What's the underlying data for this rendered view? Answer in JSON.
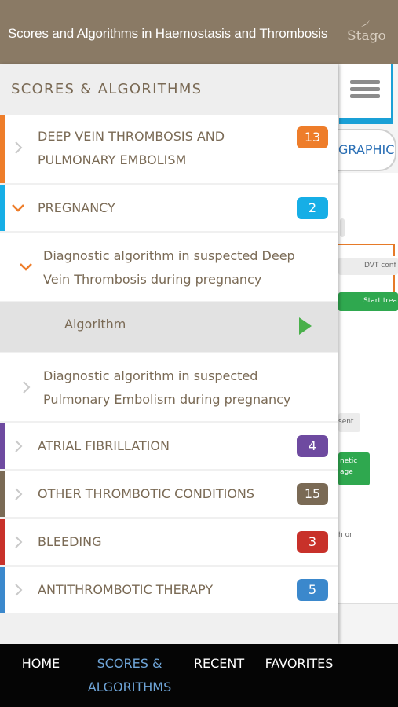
{
  "app": {
    "title": "Scores and Algorithms in Haemostasis and Thrombosis",
    "logo_text": "Stago"
  },
  "panel": {
    "title": "SCORES & ALGORITHMS"
  },
  "categories": [
    {
      "line1": "DEEP VEIN THROMBOSIS AND",
      "line2": "PULMONARY EMBOLISM",
      "count": "13",
      "color": "#ee7d2a",
      "expanded": false
    },
    {
      "line1": "PREGNANCY",
      "count": "2",
      "color": "#16aee6",
      "expanded": true
    },
    {
      "line1": "ATRIAL FIBRILLATION",
      "count": "4",
      "color": "#6e4aa0",
      "expanded": false
    },
    {
      "line1": "OTHER THROMBOTIC CONDITIONS",
      "count": "15",
      "color": "#7a6a55",
      "expanded": false
    },
    {
      "line1": "BLEEDING",
      "count": "3",
      "color": "#c8312a",
      "expanded": false
    },
    {
      "line1": "ANTITHROMBOTIC THERAPY",
      "count": "5",
      "color": "#3b88cc",
      "expanded": false
    }
  ],
  "pregnancy_items": [
    {
      "line1": "Diagnostic algorithm in suspected Deep",
      "line2": "Vein Thrombosis during pregnancy",
      "expanded": true
    },
    {
      "line1": "Diagnostic algorithm in suspected",
      "line2": "Pulmonary Embolism during pregnancy",
      "expanded": false
    }
  ],
  "algorithm_item": {
    "label": "Algorithm"
  },
  "background": {
    "tab_label": "GRAPHIC",
    "flow_labels": [
      "DVT conf",
      "Start trea",
      "sent",
      "netic",
      "age",
      "h or"
    ]
  },
  "tabbar": [
    {
      "line1": "HOME",
      "active": false
    },
    {
      "line1": "SCORES &",
      "line2": "ALGORITHMS",
      "active": true
    },
    {
      "line1": "RECENT",
      "active": false
    },
    {
      "line1": "FAVORITES",
      "active": false
    }
  ],
  "colors": {
    "accent_orange": "#ee7d2a",
    "accent_blue": "#1aa0d6",
    "play_green": "#49b04a",
    "header_brown": "#8a7a65"
  }
}
